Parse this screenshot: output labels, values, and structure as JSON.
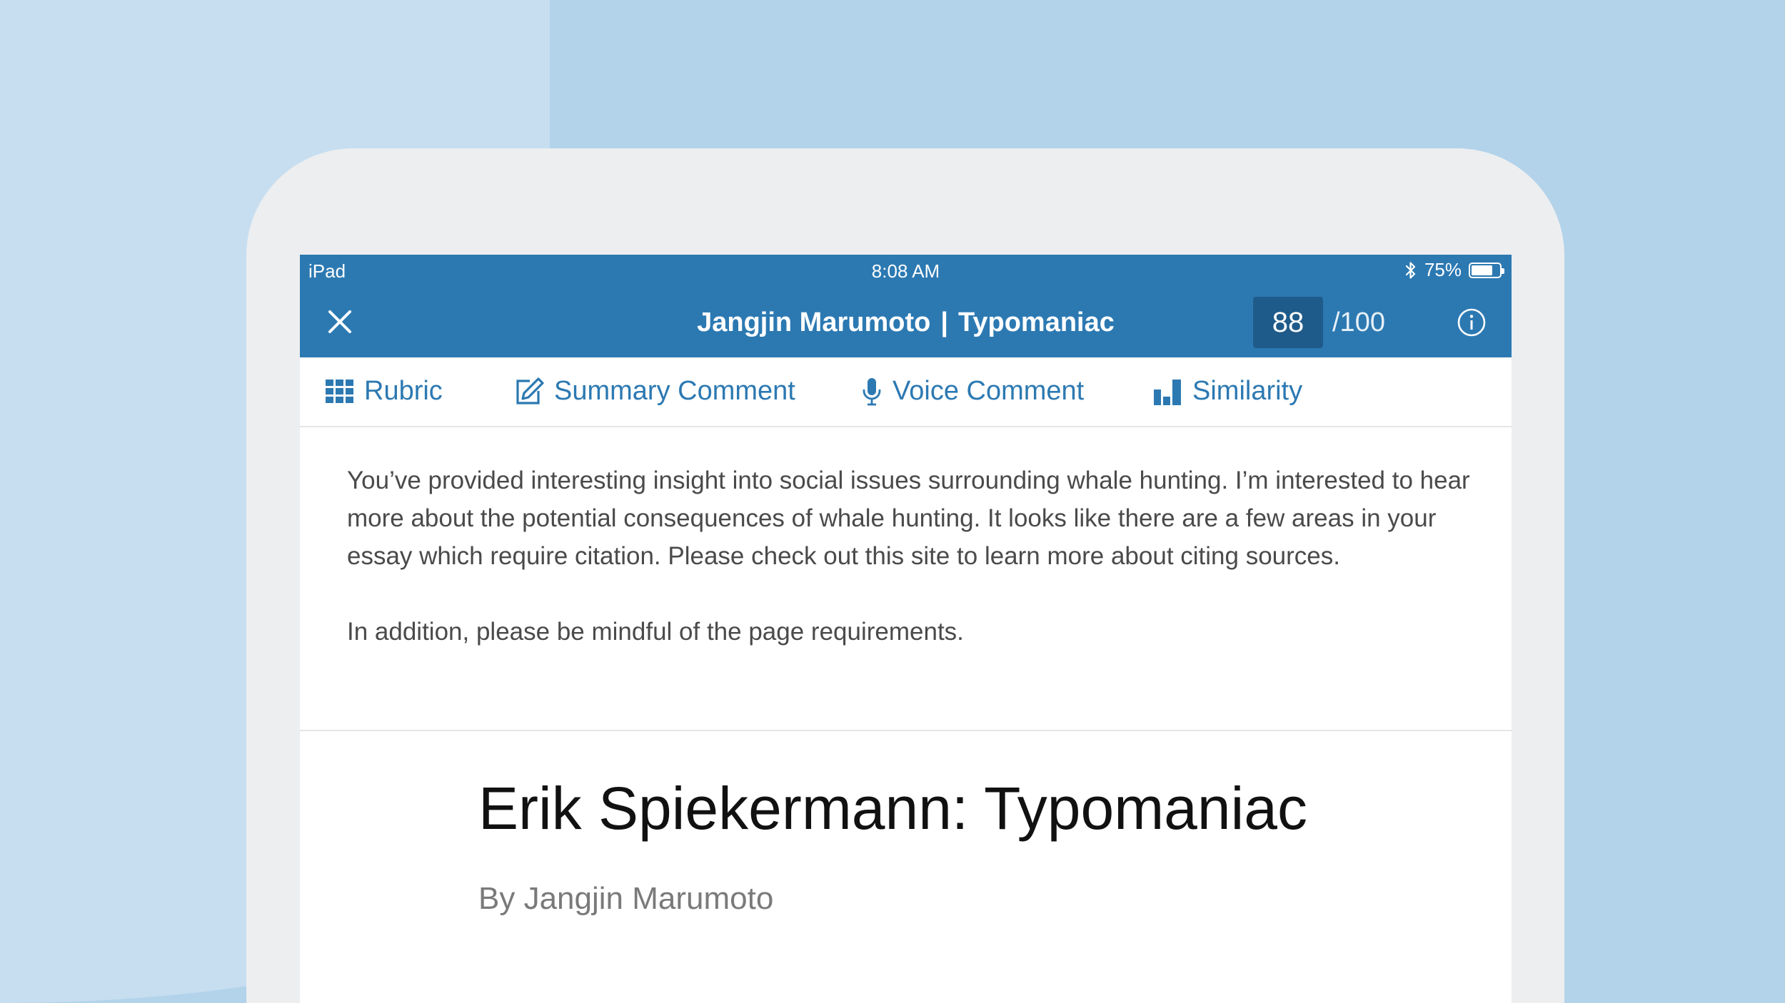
{
  "status_bar": {
    "device": "iPad",
    "time": "8:08 AM",
    "battery": "75%",
    "battery_level": 0.75
  },
  "header": {
    "student_name": "Jangjin Marumoto",
    "separator": "|",
    "assignment": "Typomaniac",
    "score": "88",
    "score_max": "/100",
    "close_icon": "close-icon",
    "info_icon": "info-icon"
  },
  "toolbar": {
    "items": [
      {
        "label": "Rubric",
        "icon": "grid-icon"
      },
      {
        "label": "Summary Comment",
        "icon": "edit-icon"
      },
      {
        "label": "Voice Comment",
        "icon": "microphone-icon"
      },
      {
        "label": "Similarity",
        "icon": "bar-chart-icon"
      }
    ]
  },
  "comment": {
    "paragraph_1": "You’ve provided interesting insight into social issues surrounding whale hunting. I’m interested to hear more about the potential consequences of whale hunting. It looks like there are a few areas in your essay which require citation. Please check out this site to learn more about citing sources.",
    "paragraph_2": "In addition, please be mindful of the page requirements."
  },
  "document": {
    "title": "Erik Spiekermann: Typomaniac",
    "byline": "By Jangjin Marumoto"
  },
  "colors": {
    "accent": "#2c79b2",
    "score_box": "#1f5b8a",
    "background": "#b2d3ea"
  }
}
